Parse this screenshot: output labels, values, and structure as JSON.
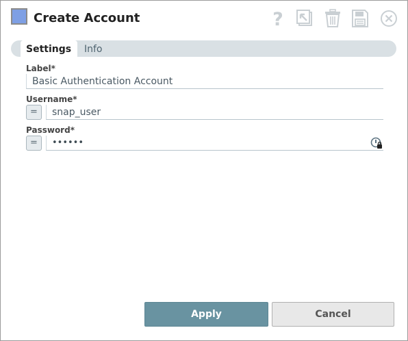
{
  "dialog": {
    "title": "Create Account",
    "accent_color": "#7e9fe4"
  },
  "toolbar": {
    "icons": [
      "help-icon",
      "export-icon",
      "delete-icon",
      "save-icon",
      "close-icon"
    ],
    "help_glyph": "?"
  },
  "tabs": [
    {
      "label": "Settings",
      "active": true
    },
    {
      "label": "Info",
      "active": false
    }
  ],
  "fields": {
    "label": {
      "label": "Label*",
      "value": "Basic Authentication Account"
    },
    "username": {
      "label": "Username*",
      "value": "snap_user",
      "expression_toggle": "="
    },
    "password": {
      "label": "Password*",
      "value": "••••••",
      "expression_toggle": "="
    }
  },
  "buttons": {
    "apply": "Apply",
    "cancel": "Cancel",
    "apply_color": "#6993a1"
  }
}
